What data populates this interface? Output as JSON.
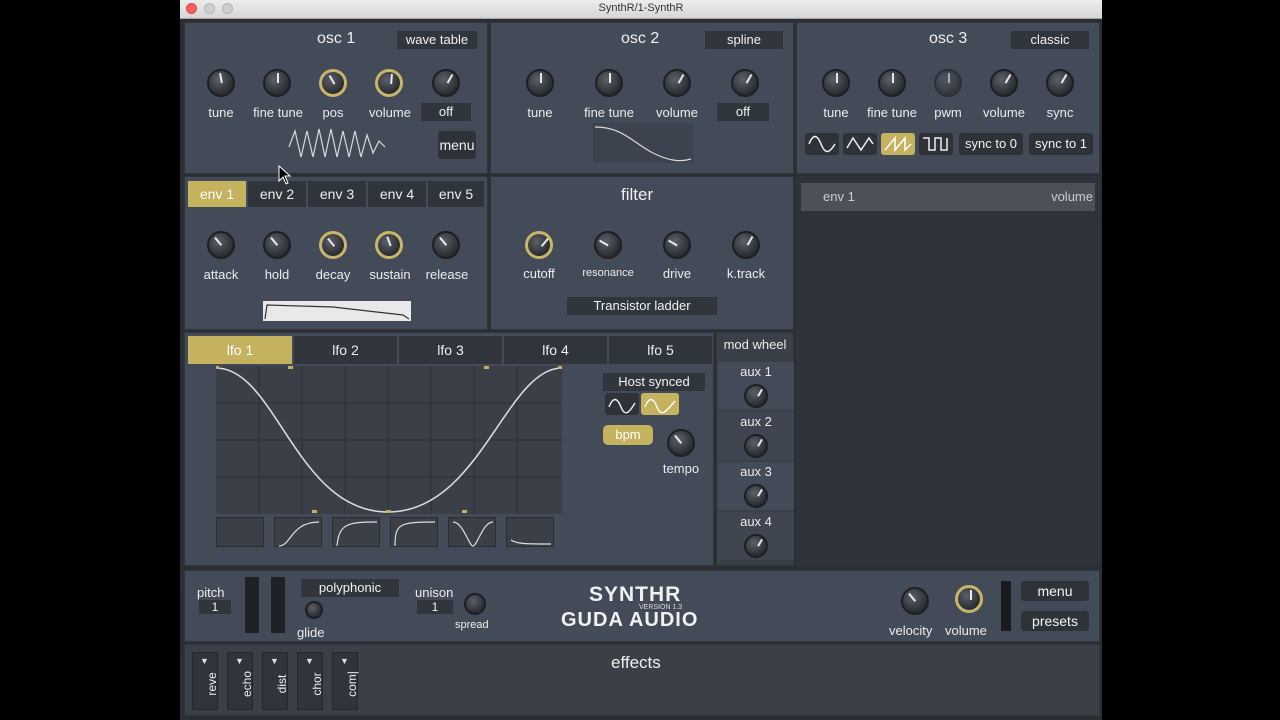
{
  "window": {
    "title": "SynthR/1-SynthR"
  },
  "osc1": {
    "title": "osc 1",
    "mode": "wave table",
    "knobs": [
      "tune",
      "fine tune",
      "pos",
      "volume"
    ],
    "off_label": "off",
    "menu_label": "menu"
  },
  "osc2": {
    "title": "osc 2",
    "mode": "spline",
    "knobs": [
      "tune",
      "fine tune",
      "volume"
    ],
    "off_label": "off"
  },
  "osc3": {
    "title": "osc 3",
    "mode": "classic",
    "knobs": [
      "tune",
      "fine tune",
      "pwm",
      "volume",
      "sync"
    ],
    "sync0": "sync to 0",
    "sync1": "sync to 1",
    "waveshape_icons": [
      "sine-wave-icon",
      "triangle-wave-icon",
      "saw-wave-icon",
      "square-wave-icon"
    ],
    "selected_shape": "saw-wave-icon"
  },
  "env": {
    "tabs": [
      "env 1",
      "env 2",
      "env 3",
      "env 4",
      "env 5"
    ],
    "active_tab": "env 1",
    "knobs": [
      "attack",
      "hold",
      "decay",
      "sustain",
      "release"
    ]
  },
  "filter": {
    "title": "filter",
    "knobs": [
      "cutoff",
      "resonance",
      "drive",
      "k.track"
    ],
    "type": "Transistor ladder"
  },
  "modmatrix": {
    "source": "env 1",
    "target": "volume"
  },
  "lfo": {
    "tabs": [
      "lfo 1",
      "lfo 2",
      "lfo 3",
      "lfo 4",
      "lfo 5"
    ],
    "active_tab": "lfo 1",
    "sync_label": "Host synced",
    "bpm_label": "bpm",
    "tempo_label": "tempo"
  },
  "aux": {
    "header": "mod wheel",
    "items": [
      "aux 1",
      "aux 2",
      "aux 3",
      "aux 4"
    ]
  },
  "bottom": {
    "pitch_label": "pitch",
    "pitch_value": "1",
    "voice_mode": "polyphonic",
    "glide_label": "glide",
    "unison_label": "unison",
    "unison_value": "1",
    "spread_label": "spread",
    "logo_line1": "SYNTHR",
    "logo_version": "VERSION 1.3",
    "logo_line2": "GUDA AUDIO",
    "velocity_label": "velocity",
    "volume_label": "volume",
    "menu_label": "menu",
    "presets_label": "presets"
  },
  "effects": {
    "title": "effects",
    "slots": [
      "reve",
      "echo",
      "dist",
      "chor",
      "com|"
    ]
  },
  "colors": {
    "accent": "#c4b25e",
    "panel": "#434a58",
    "dark": "#2b2e33"
  }
}
